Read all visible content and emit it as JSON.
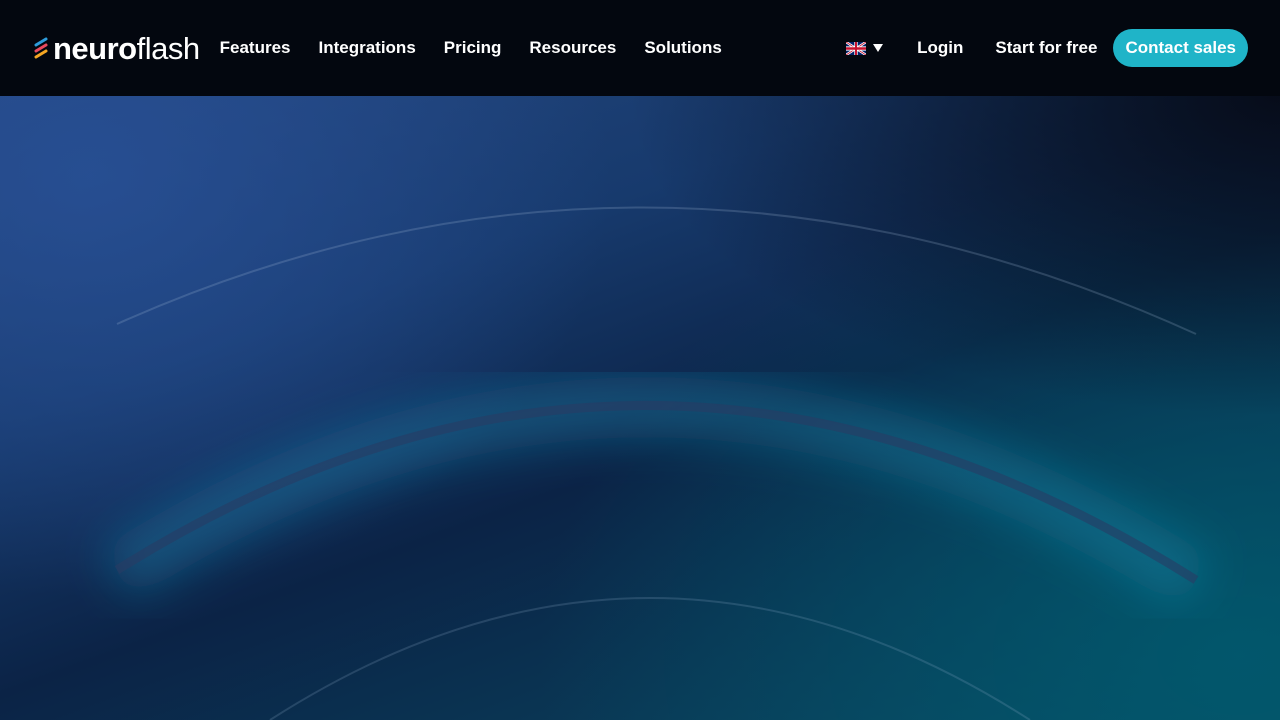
{
  "header": {
    "logo": {
      "bold_part": "neuro",
      "light_part": "flash",
      "mark_colors": [
        "#2d9cdb",
        "#e84a5f",
        "#f5a623"
      ]
    },
    "nav": [
      {
        "label": "Features"
      },
      {
        "label": "Integrations"
      },
      {
        "label": "Pricing"
      },
      {
        "label": "Resources"
      },
      {
        "label": "Solutions"
      }
    ],
    "language": {
      "icon": "uk-flag-icon",
      "dropdown_icon": "caret-down-icon"
    },
    "login_label": "Login",
    "start_label": "Start for free",
    "contact_label": "Contact sales"
  },
  "colors": {
    "header_bg": "#03070f",
    "accent": "#1fb4c8",
    "hero_blue": "#24467e",
    "hero_teal": "#0a4a63"
  }
}
